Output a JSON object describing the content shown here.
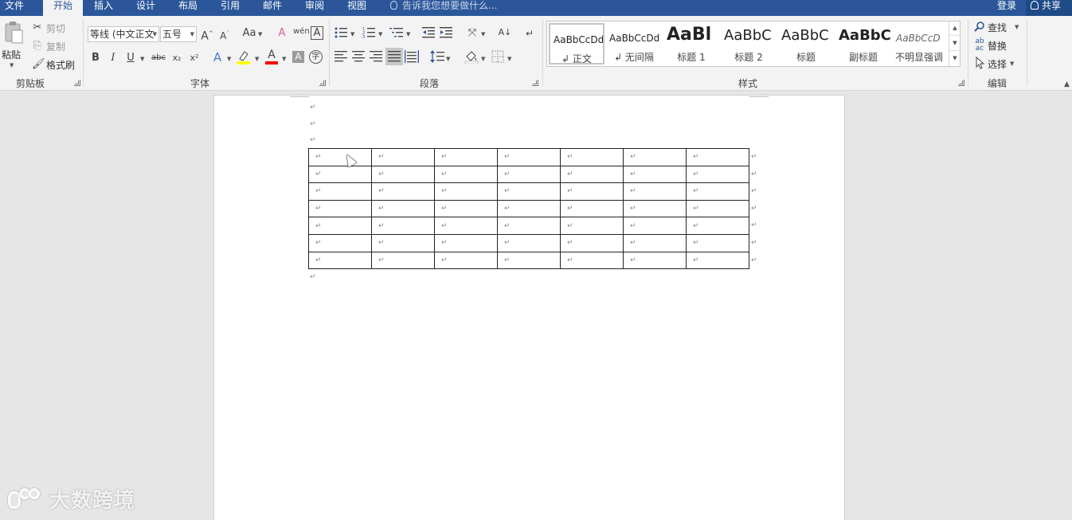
{
  "tabs": [
    {
      "label": "文件",
      "active": false
    },
    {
      "label": "开始",
      "active": true
    },
    {
      "label": "插入",
      "active": false
    },
    {
      "label": "设计",
      "active": false
    },
    {
      "label": "布局",
      "active": false
    },
    {
      "label": "引用",
      "active": false
    },
    {
      "label": "邮件",
      "active": false
    },
    {
      "label": "审阅",
      "active": false
    },
    {
      "label": "视图",
      "active": false
    }
  ],
  "tell_me": "告诉我您想要做什么...",
  "account": {
    "login": "登录",
    "share": "共享"
  },
  "clipboard": {
    "paste": "粘贴",
    "cut": "剪切",
    "copy": "复制",
    "format_painter": "格式刷",
    "group_label": "剪贴板"
  },
  "font": {
    "font_name": "等线 (中文正文",
    "font_size": "五号",
    "group_label": "字体",
    "bold": "B",
    "italic": "I",
    "underline": "U",
    "strike": "abc",
    "subscript": "x₂",
    "superscript": "x²",
    "grow": "A",
    "shrink": "A",
    "case": "Aa",
    "phonetic": "wén",
    "border_char": "A",
    "effects": "A",
    "font_color": "A",
    "char_shading": "A",
    "enclose": "字",
    "colors": {
      "highlight": "#ffff00",
      "font_color": "#ff0000"
    }
  },
  "paragraph": {
    "group_label": "段落"
  },
  "styles": {
    "group_label": "样式",
    "items": [
      {
        "sample": "AaBbCcDd",
        "name": "↲ 正文",
        "selected": true
      },
      {
        "sample": "AaBbCcDd",
        "name": "↲ 无间隔",
        "selected": false
      },
      {
        "sample": "AaBl",
        "name": "标题 1",
        "selected": false
      },
      {
        "sample": "AaBbC",
        "name": "标题 2",
        "selected": false
      },
      {
        "sample": "AaBbC",
        "name": "标题",
        "selected": false
      },
      {
        "sample": "AaBbC",
        "name": "副标题",
        "selected": false
      },
      {
        "sample": "AaBbCcD",
        "name": "不明显强调",
        "selected": false
      }
    ]
  },
  "editing": {
    "find": "查找",
    "replace": "替换",
    "select": "选择",
    "group_label": "编辑"
  },
  "document": {
    "para_mark": "↵",
    "table": {
      "rows": 7,
      "cols": 7
    }
  },
  "watermark": "大数跨境",
  "theme": {
    "accent": "#2b579a"
  }
}
